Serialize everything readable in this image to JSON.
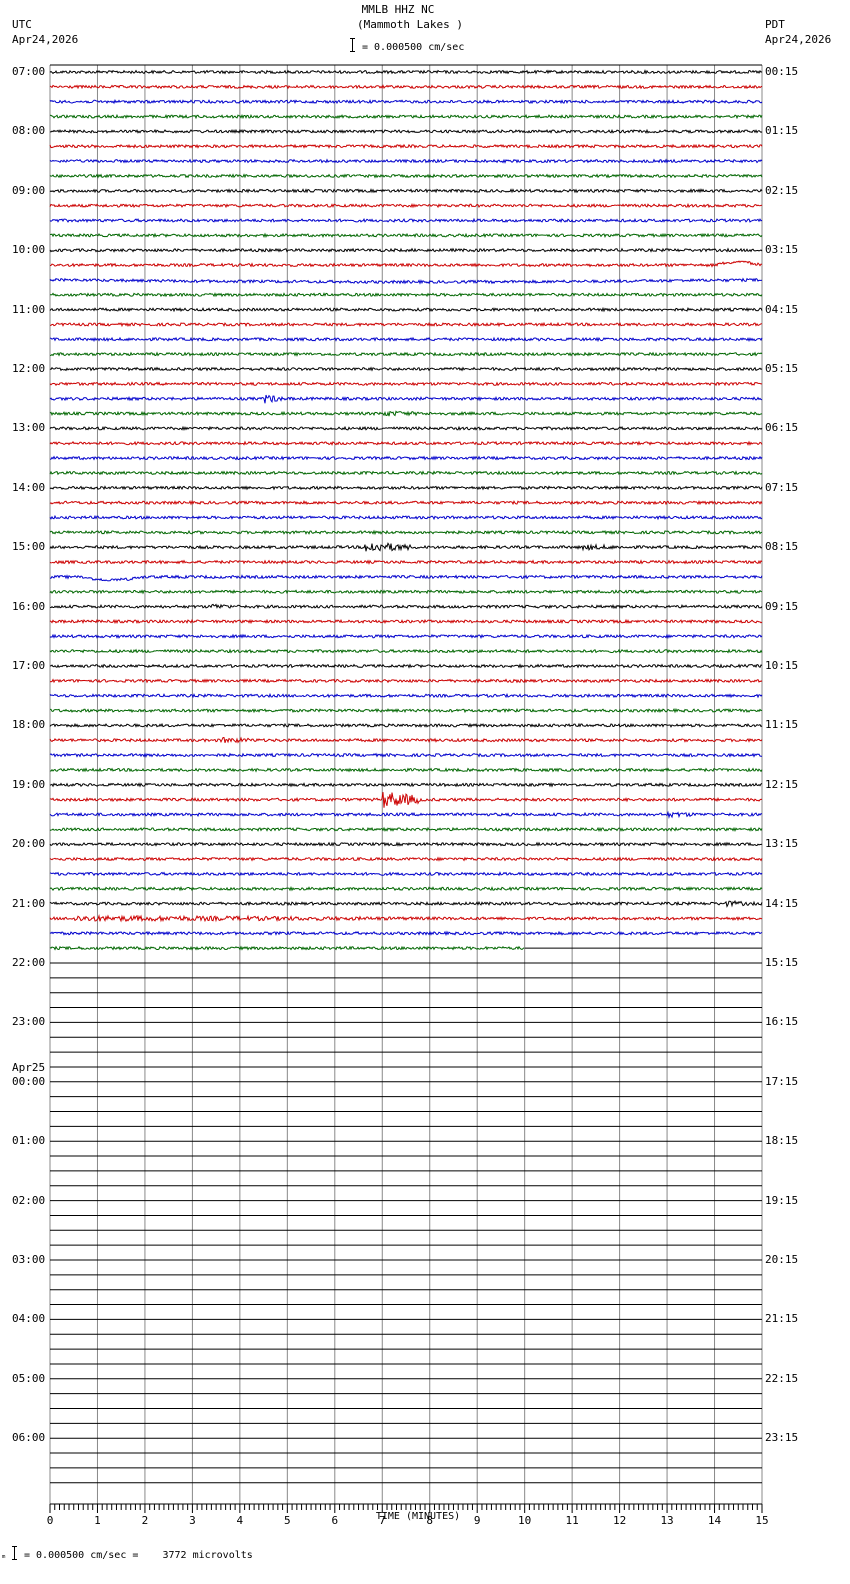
{
  "header": {
    "station": "MMLB HHZ NC",
    "location": "(Mammoth Lakes )",
    "left_tz": "UTC",
    "left_date": "Apr24,2026",
    "right_tz": "PDT",
    "right_date": "Apr24,2026",
    "scale_text": "= 0.000500 cm/sec"
  },
  "footer": {
    "mark": "ₘ",
    "scale_text": "= 0.000500 cm/sec =    3772 microvolts"
  },
  "chart_data": {
    "type": "line",
    "subtype": "helicorder",
    "xlabel": "TIME (MINUTES)",
    "xlim": [
      0,
      15
    ],
    "x_ticks": [
      "0",
      "1",
      "2",
      "3",
      "4",
      "5",
      "6",
      "7",
      "8",
      "9",
      "10",
      "11",
      "12",
      "13",
      "14",
      "15"
    ],
    "minutes_per_row": 15,
    "rows_total": 96,
    "rows_with_data": 60,
    "last_row_data_end_minute": 10,
    "trace_colors": [
      "#000000",
      "#cc0000",
      "#0000cc",
      "#006600"
    ],
    "left_labels": [
      {
        "row": 0,
        "text": "07:00"
      },
      {
        "row": 4,
        "text": "08:00"
      },
      {
        "row": 8,
        "text": "09:00"
      },
      {
        "row": 12,
        "text": "10:00"
      },
      {
        "row": 16,
        "text": "11:00"
      },
      {
        "row": 20,
        "text": "12:00"
      },
      {
        "row": 24,
        "text": "13:00"
      },
      {
        "row": 28,
        "text": "14:00"
      },
      {
        "row": 32,
        "text": "15:00"
      },
      {
        "row": 36,
        "text": "16:00"
      },
      {
        "row": 40,
        "text": "17:00"
      },
      {
        "row": 44,
        "text": "18:00"
      },
      {
        "row": 48,
        "text": "19:00"
      },
      {
        "row": 52,
        "text": "20:00"
      },
      {
        "row": 56,
        "text": "21:00"
      },
      {
        "row": 60,
        "text": "22:00"
      },
      {
        "row": 64,
        "text": "23:00"
      },
      {
        "row": 68,
        "text": "00:00",
        "date": "Apr25"
      },
      {
        "row": 72,
        "text": "01:00"
      },
      {
        "row": 76,
        "text": "02:00"
      },
      {
        "row": 80,
        "text": "03:00"
      },
      {
        "row": 84,
        "text": "04:00"
      },
      {
        "row": 88,
        "text": "05:00"
      },
      {
        "row": 92,
        "text": "06:00"
      }
    ],
    "right_labels": [
      {
        "row": 0,
        "text": "00:15"
      },
      {
        "row": 4,
        "text": "01:15"
      },
      {
        "row": 8,
        "text": "02:15"
      },
      {
        "row": 12,
        "text": "03:15"
      },
      {
        "row": 16,
        "text": "04:15"
      },
      {
        "row": 20,
        "text": "05:15"
      },
      {
        "row": 24,
        "text": "06:15"
      },
      {
        "row": 28,
        "text": "07:15"
      },
      {
        "row": 32,
        "text": "08:15"
      },
      {
        "row": 36,
        "text": "09:15"
      },
      {
        "row": 40,
        "text": "10:15"
      },
      {
        "row": 44,
        "text": "11:15"
      },
      {
        "row": 48,
        "text": "12:15"
      },
      {
        "row": 52,
        "text": "13:15"
      },
      {
        "row": 56,
        "text": "14:15"
      },
      {
        "row": 60,
        "text": "15:15"
      },
      {
        "row": 64,
        "text": "16:15"
      },
      {
        "row": 68,
        "text": "17:15"
      },
      {
        "row": 72,
        "text": "18:15"
      },
      {
        "row": 76,
        "text": "19:15"
      },
      {
        "row": 80,
        "text": "20:15"
      },
      {
        "row": 84,
        "text": "21:15"
      },
      {
        "row": 88,
        "text": "22:15"
      },
      {
        "row": 92,
        "text": "23:15"
      }
    ],
    "events": [
      {
        "row": 13,
        "minute": 14.0,
        "duration": 1.0,
        "amplitude": 3,
        "kind": "drift"
      },
      {
        "row": 14,
        "minute": 0,
        "duration": 15,
        "amplitude": 2,
        "kind": "drift"
      },
      {
        "row": 22,
        "minute": 4.5,
        "duration": 0.4,
        "amplitude": 5
      },
      {
        "row": 23,
        "minute": 7.0,
        "duration": 1.0,
        "amplitude": 3
      },
      {
        "row": 32,
        "minute": 6.6,
        "duration": 1.0,
        "amplitude": 6
      },
      {
        "row": 32,
        "minute": 11.2,
        "duration": 1.0,
        "amplitude": 3
      },
      {
        "row": 34,
        "minute": 0.6,
        "duration": 1.4,
        "amplitude": 3,
        "kind": "drift"
      },
      {
        "row": 36,
        "minute": 3.4,
        "duration": 0.6,
        "amplitude": 3
      },
      {
        "row": 45,
        "minute": 3.6,
        "duration": 1.0,
        "amplitude": 3
      },
      {
        "row": 49,
        "minute": 7.0,
        "duration": 0.8,
        "amplitude": 9
      },
      {
        "row": 50,
        "minute": 13.0,
        "duration": 0.8,
        "amplitude": 3
      },
      {
        "row": 56,
        "minute": 14.2,
        "duration": 0.8,
        "amplitude": 3
      },
      {
        "row": 57,
        "minute": 0.5,
        "duration": 8.5,
        "amplitude": 3
      }
    ]
  }
}
